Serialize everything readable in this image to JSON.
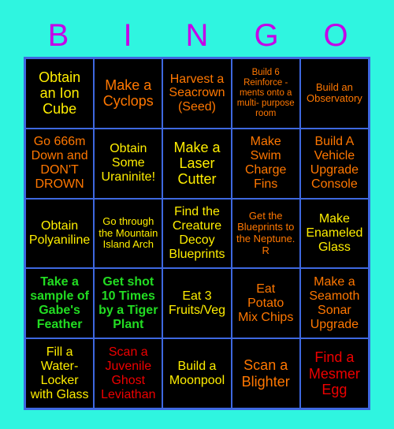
{
  "card": {
    "title": "BINGO",
    "background_color": "#2ff5e0",
    "cell_background_color": "#000000",
    "grid_line_color": "#3e68e0",
    "header_letter_color": "#c500e8",
    "header_letters": [
      "B",
      "I",
      "N",
      "G",
      "O"
    ],
    "colors": {
      "yellow": "#ffee00",
      "orange": "#ff7700",
      "green": "#22dd22",
      "red": "#ee0000"
    },
    "rows": [
      [
        {
          "text": "Obtain\nan Ion\nCube",
          "color": "yellow",
          "size": "lg"
        },
        {
          "text": "Make a\nCyclops",
          "color": "orange",
          "size": "lg"
        },
        {
          "text": "Harvest a\nSeacrown\n(Seed)",
          "color": "orange",
          "size": "md"
        },
        {
          "text": "Build 6\nReinforce -\nments onto a\nmulti- purpose\nroom",
          "color": "orange",
          "size": "xs"
        },
        {
          "text": "Build an\nObservatory",
          "color": "orange",
          "size": "sm"
        }
      ],
      [
        {
          "text": "Go 666m\nDown and\nDON'T\nDROWN",
          "color": "orange",
          "size": "md"
        },
        {
          "text": "Obtain\nSome\nUraninite!",
          "color": "yellow",
          "size": "md"
        },
        {
          "text": "Make a\nLaser\nCutter",
          "color": "yellow",
          "size": "lg"
        },
        {
          "text": "Make\nSwim\nCharge\nFins",
          "color": "orange",
          "size": "md"
        },
        {
          "text": "Build A\nVehicle\nUpgrade\nConsole",
          "color": "orange",
          "size": "md"
        }
      ],
      [
        {
          "text": "Obtain\nPolyaniline",
          "color": "yellow",
          "size": "md"
        },
        {
          "text": "Go through\nthe Mountain\nIsland Arch",
          "color": "yellow",
          "size": "sm"
        },
        {
          "text": "Find the\nCreature\nDecoy\nBlueprints",
          "color": "yellow",
          "size": "md"
        },
        {
          "text": "Get the\nBlueprints to\nthe Neptune.\nR",
          "color": "orange",
          "size": "sm"
        },
        {
          "text": "Make\nEnameled\nGlass",
          "color": "yellow",
          "size": "md"
        }
      ],
      [
        {
          "text": "Take a\nsample of\nGabe's\nFeather",
          "color": "green",
          "size": "md"
        },
        {
          "text": "Get shot\n10 Times\nby a Tiger\nPlant",
          "color": "green",
          "size": "md"
        },
        {
          "text": "Eat 3\nFruits/Veg",
          "color": "yellow",
          "size": "md"
        },
        {
          "text": "Eat\nPotato\nMix Chips",
          "color": "orange",
          "size": "md"
        },
        {
          "text": "Make a\nSeamoth\nSonar\nUpgrade",
          "color": "orange",
          "size": "md"
        }
      ],
      [
        {
          "text": "Fill a\nWater-\nLocker\nwith Glass",
          "color": "yellow",
          "size": "md"
        },
        {
          "text": "Scan a\nJuvenile\nGhost\nLeviathan",
          "color": "red",
          "size": "md"
        },
        {
          "text": "Build a\nMoonpool",
          "color": "yellow",
          "size": "md"
        },
        {
          "text": "Scan a\nBlighter",
          "color": "orange",
          "size": "lg"
        },
        {
          "text": "Find a\nMesmer\nEgg",
          "color": "red",
          "size": "lg"
        }
      ]
    ]
  }
}
